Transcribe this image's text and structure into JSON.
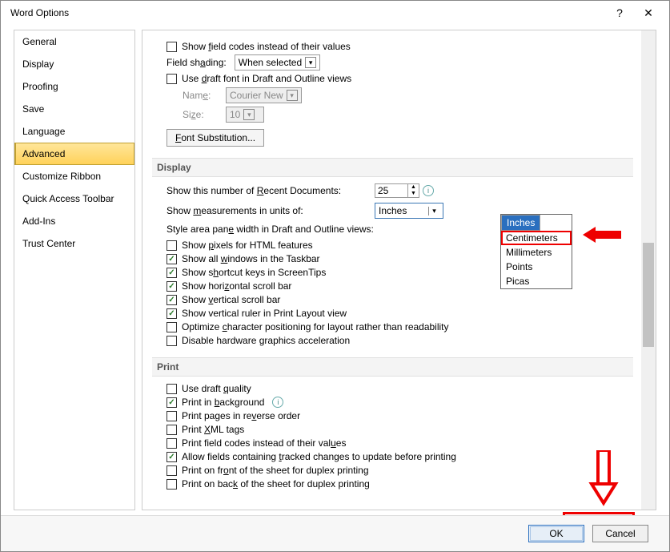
{
  "title": "Word Options",
  "side": {
    "items": [
      "General",
      "Display",
      "Proofing",
      "Save",
      "Language",
      "Advanced",
      "Customize Ribbon",
      "Quick Access Toolbar",
      "Add-Ins",
      "Trust Center"
    ],
    "selected": 5
  },
  "top_options": {
    "show_field_codes": "Show field codes instead of their values",
    "field_shading_label": "Field shading:",
    "field_shading_value": "When selected",
    "use_draft_font": "Use draft font in Draft and Outline views",
    "name_label": "Name:",
    "name_value": "Courier New",
    "size_label": "Size:",
    "size_value": "10",
    "font_sub_btn": "Font Substitution..."
  },
  "display_section": {
    "heading": "Display",
    "recent_docs_label": "Show this number of Recent Documents:",
    "recent_docs_value": "25",
    "units_label": "Show measurements in units of:",
    "units_value": "Inches",
    "style_area_label": "Style area pane width in Draft and Outline views:",
    "unit_options": [
      "Inches",
      "Centimeters",
      "Millimeters",
      "Points",
      "Picas"
    ],
    "checkboxes": [
      {
        "label": "Show pixels for HTML features",
        "checked": false
      },
      {
        "label": "Show all windows in the Taskbar",
        "checked": true
      },
      {
        "label": "Show shortcut keys in ScreenTips",
        "checked": true
      },
      {
        "label": "Show horizontal scroll bar",
        "checked": true
      },
      {
        "label": "Show vertical scroll bar",
        "checked": true
      },
      {
        "label": "Show vertical ruler in Print Layout view",
        "checked": true
      },
      {
        "label": "Optimize character positioning for layout rather than readability",
        "checked": false
      },
      {
        "label": "Disable hardware graphics acceleration",
        "checked": false
      }
    ]
  },
  "print_section": {
    "heading": "Print",
    "checkboxes": [
      {
        "label": "Use draft quality",
        "checked": false
      },
      {
        "label": "Print in background",
        "checked": true,
        "info": true
      },
      {
        "label": "Print pages in reverse order",
        "checked": false
      },
      {
        "label": "Print XML tags",
        "checked": false
      },
      {
        "label": "Print field codes instead of their values",
        "checked": false
      },
      {
        "label": "Allow fields containing tracked changes to update before printing",
        "checked": true
      },
      {
        "label": "Print on front of the sheet for duplex printing",
        "checked": false
      },
      {
        "label": "Print on back of the sheet for duplex printing",
        "checked": false
      }
    ]
  },
  "footer": {
    "ok": "OK",
    "cancel": "Cancel"
  }
}
